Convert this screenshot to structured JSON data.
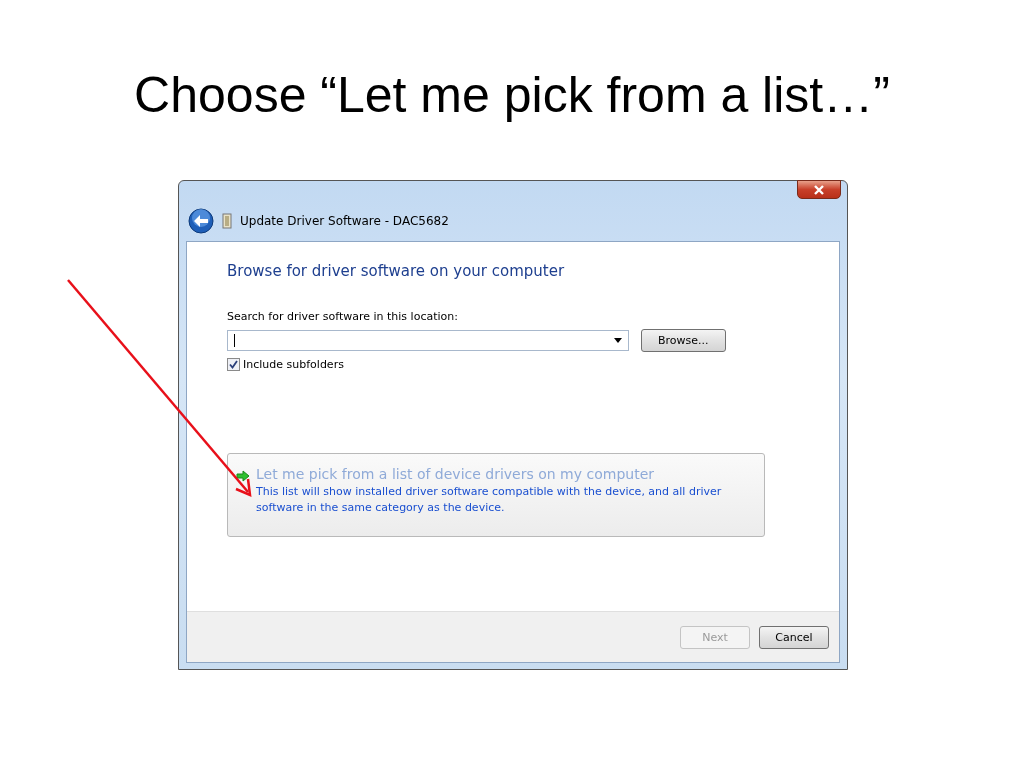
{
  "slide_title": "Choose “Let me pick from a list…”",
  "dialog": {
    "title": "Update Driver Software - DAC5682",
    "heading": "Browse for driver software on your computer",
    "location_label": "Search for driver software in this location:",
    "browse_button": "Browse...",
    "include_subfolders": {
      "label": "Include subfolders",
      "checked": true
    },
    "option": {
      "title": "Let me pick from a list of device drivers on my computer",
      "description": "This list will show installed driver software compatible with the device, and all driver software in the same category as the device."
    },
    "buttons": [
      {
        "label": "Next",
        "disabled": true
      },
      {
        "label": "Cancel",
        "disabled": false
      }
    ]
  }
}
